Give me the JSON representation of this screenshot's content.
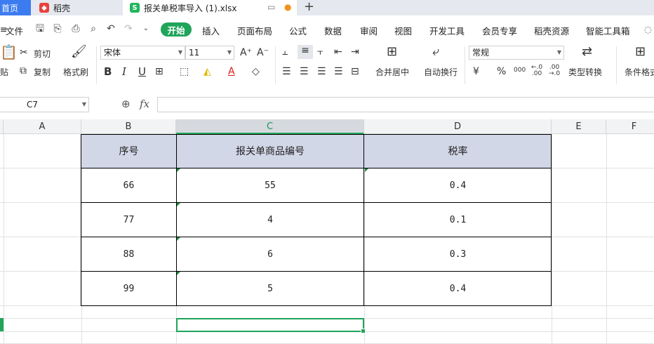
{
  "titlebar": {
    "home_tab": "首页",
    "tab1": "稻壳",
    "tab2": "报关单税率导入 (1).xlsx",
    "new_tab": "+"
  },
  "menu": {
    "file": "文件",
    "items": [
      "开始",
      "插入",
      "页面布局",
      "公式",
      "数据",
      "审阅",
      "视图",
      "开发工具",
      "会员专享",
      "稻壳资源",
      "智能工具箱"
    ]
  },
  "ribbon": {
    "paste": "贴",
    "cut": "剪切",
    "copy": "复制",
    "format_painter": "格式刷",
    "font_name": "宋体",
    "font_size": "11",
    "merge_center": "合并居中",
    "wrap_text": "自动换行",
    "number_format": "常规",
    "type_convert": "类型转换",
    "cond_format": "条件格式",
    "bold": "B",
    "italic": "I",
    "underline": "U",
    "currency": "¥",
    "percent": "%",
    "thousands": "000",
    "inc_decimal": "←.0\n.00",
    "dec_decimal": ".00\n→.0"
  },
  "formula_bar": {
    "name_box": "C7",
    "fx": "fx",
    "value": ""
  },
  "columns": [
    "A",
    "B",
    "C",
    "D",
    "E",
    "F"
  ],
  "active_column": "C",
  "table": {
    "headers": [
      "序号",
      "报关单商品编号",
      "税率"
    ],
    "rows": [
      [
        "66",
        "55",
        "0.4"
      ],
      [
        "77",
        "4",
        "0.1"
      ],
      [
        "88",
        "6",
        "0.3"
      ],
      [
        "99",
        "5",
        "0.4"
      ]
    ]
  },
  "colors": {
    "accent": "#1fa45a",
    "home_tab": "#3d7cf0",
    "header_fill": "#d2d7e7"
  }
}
